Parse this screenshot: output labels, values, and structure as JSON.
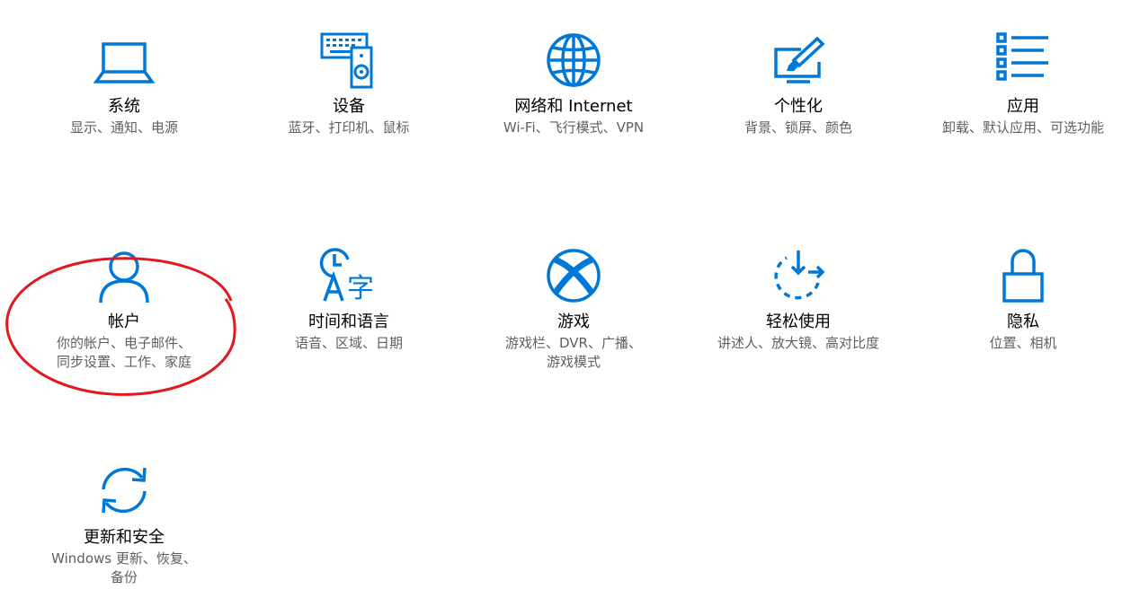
{
  "accent_color": "#0078d7",
  "highlight_color": "#e0191f",
  "tiles": [
    {
      "icon": "laptop-icon",
      "title": "系统",
      "subtitle": "显示、通知、电源"
    },
    {
      "icon": "keyboard-speaker-icon",
      "title": "设备",
      "subtitle": "蓝牙、打印机、鼠标"
    },
    {
      "icon": "globe-icon",
      "title": "网络和 Internet",
      "subtitle": "Wi-Fi、飞行模式、VPN"
    },
    {
      "icon": "paint-brush-icon",
      "title": "个性化",
      "subtitle": "背景、锁屏、颜色"
    },
    {
      "icon": "apps-list-icon",
      "title": "应用",
      "subtitle": "卸载、默认应用、可选功能"
    },
    {
      "icon": "person-icon",
      "title": "帐户",
      "subtitle": "你的帐户、电子邮件、同步设置、工作、家庭"
    },
    {
      "icon": "time-language-icon",
      "title": "时间和语言",
      "subtitle": "语音、区域、日期"
    },
    {
      "icon": "xbox-icon",
      "title": "游戏",
      "subtitle": "游戏栏、DVR、广播、游戏模式"
    },
    {
      "icon": "ease-of-access-icon",
      "title": "轻松使用",
      "subtitle": "讲述人、放大镜、高对比度"
    },
    {
      "icon": "lock-icon",
      "title": "隐私",
      "subtitle": "位置、相机"
    },
    {
      "icon": "sync-icon",
      "title": "更新和安全",
      "subtitle": "Windows 更新、恢复、备份"
    }
  ]
}
